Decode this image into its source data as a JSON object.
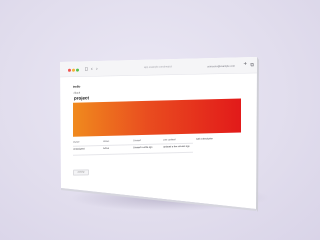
{
  "browser": {
    "address": "app.example.com/project",
    "user_email": "someone@example.com",
    "new_tab_label": "+",
    "tabs_icon": "tabs-icon",
    "sidebar_icon": "sidebar-icon",
    "back_icon": "back-icon",
    "forward_icon": "forward-icon"
  },
  "page": {
    "brand": "trello",
    "back_link": "‹ Back",
    "title": "project",
    "hero_gradient": [
      "#f08a1e",
      "#e94c1f",
      "#e21a1a"
    ]
  },
  "fields": [
    {
      "label": "Owner",
      "value": "Unassigned"
    },
    {
      "label": "Status",
      "value": "Active"
    },
    {
      "label": "Created",
      "value": "Created a while ago"
    },
    {
      "label": "Last updated",
      "value": "Updated a few minutes ago"
    },
    {
      "label": "",
      "value": "Add a description"
    }
  ],
  "footer": {
    "chip_label": "Activity"
  }
}
